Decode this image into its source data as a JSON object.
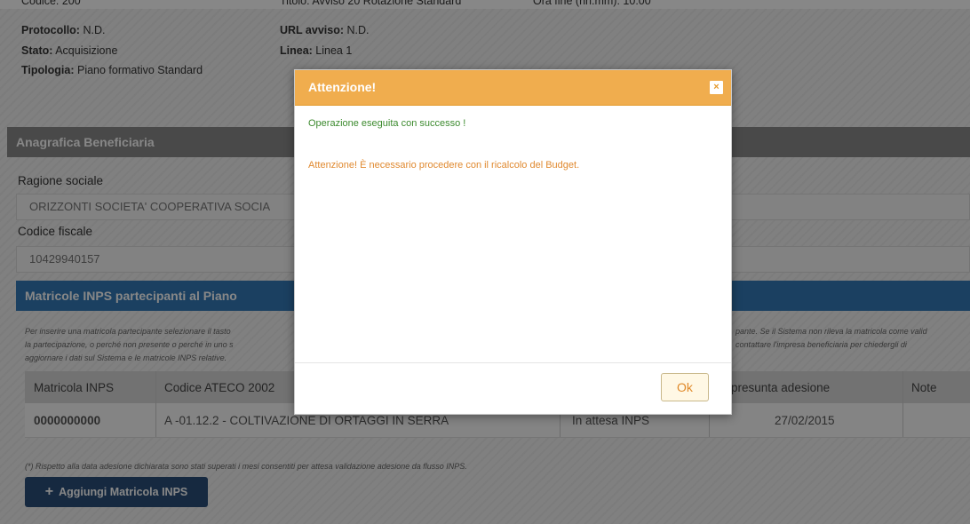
{
  "header": {
    "codice": "Codice: 200",
    "titolo": "Titolo: Avviso 20 Rotazione Standard",
    "ora_fine": "Ora fine (hh:mm): 10:00"
  },
  "details": {
    "protocollo_label": "Protocollo:",
    "protocollo_value": "N.D.",
    "url_label": "URL avviso:",
    "url_value": "N.D.",
    "stato_label": "Stato:",
    "stato_value": "Acquisizione",
    "linea_label": "Linea:",
    "linea_value": "Linea 1",
    "tipologia_label": "Tipologia:",
    "tipologia_value": "Piano formativo Standard"
  },
  "anagrafica": {
    "title": "Anagrafica Beneficiaria",
    "ragione_label": "Ragione sociale",
    "ragione_value": "ORIZZONTI SOCIETA' COOPERATIVA SOCIA",
    "cf_label": "Codice fiscale",
    "cf_value": "10429940157"
  },
  "matricole": {
    "title": "Matricole INPS partecipanti al Piano",
    "note_line1_left": "Per inserire una matricola partecipante selezionare il tasto",
    "note_line1_right": "pante. Se il Sistema non rileva la matricola come valid",
    "note_line2_left": "la partecipazione, o perché non presente o perché in uno s",
    "note_line2_right": "contattare l'impresa beneficiaria per chiedergli di",
    "note_line3": "aggiornare i dati sul Sistema e le matricole INPS relative.",
    "columns": [
      "Matricola INPS",
      "Codice ATECO 2002",
      "",
      "ta presunta adesione",
      "Note"
    ],
    "row": {
      "matricola": "0000000000",
      "ateco": "A -01.12.2 - COLTIVAZIONE DI ORTAGGI IN SERRA",
      "stato": "In attesa INPS",
      "data": "27/02/2015",
      "note": ""
    },
    "footnote": "(*) Rispetto alla data adesione dichiarata sono stati superati i mesi consentiti per attesa validazione adesione da flusso INPS.",
    "add_button": "Aggiungi Matricola INPS"
  },
  "modal": {
    "title": "Attenzione!",
    "close_glyph": "×",
    "success_message": "Operazione eseguita con successo !",
    "warning_message": "Attenzione! È necessario procedere con il ricalcolo del Budget.",
    "ok_label": "Ok"
  },
  "colors": {
    "modal_header": "#f0ad4e",
    "success": "#3c8a2e",
    "warning": "#e0892f",
    "section_blue": "#337ab7",
    "button_blue": "#2a4f7a"
  }
}
